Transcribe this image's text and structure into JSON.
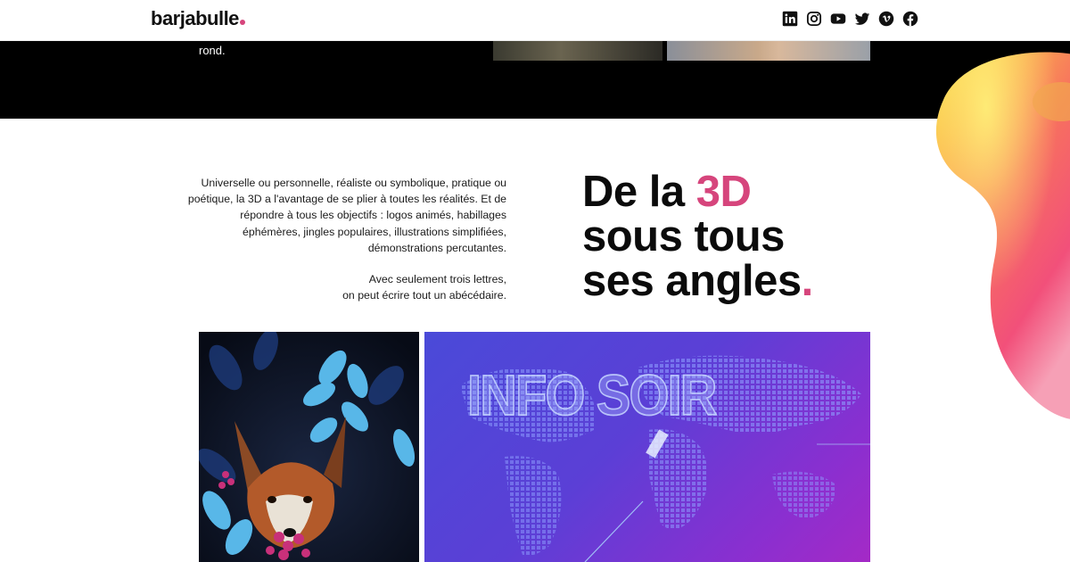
{
  "header": {
    "logo_text": "barjabulle",
    "logo_dot": ".",
    "socials": [
      "linkedin-icon",
      "instagram-icon",
      "youtube-icon",
      "twitter-icon",
      "vimeo-icon",
      "facebook-icon"
    ]
  },
  "band": {
    "text": "rond."
  },
  "section": {
    "paragraph1": "Universelle ou personnelle, réaliste ou symbolique, pratique ou poétique, la 3D a l'avantage de se plier à toutes les réalités. Et de répondre à tous les objectifs : logos animés, habillages éphémères, jingles populaires, illustrations simplifiées, démonstrations percutantes.",
    "paragraph2_line1": "Avec seulement trois lettres,",
    "paragraph2_line2": "on peut écrire tout un abécédaire.",
    "headline_part1": "De la ",
    "headline_accent": "3D",
    "headline_line2": "sous tous",
    "headline_line3": "ses angles",
    "headline_dot": "."
  },
  "media": {
    "info_title": "INFO SOIR"
  },
  "colors": {
    "accent": "#d6457c",
    "band": "#000000",
    "text": "#111111"
  }
}
